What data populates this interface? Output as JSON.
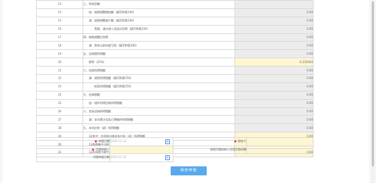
{
  "rows": [
    {
      "no": "13",
      "desc": "三、利润总额",
      "value": "",
      "indent": 0,
      "yellow": false
    },
    {
      "no": "14",
      "desc": "加：纳税调整增加额（填写附表140）",
      "value": "0.00",
      "indent": 1,
      "yellow": false
    },
    {
      "no": "15",
      "desc": "减：纳税调整减少额（填写附表140）",
      "value": "0.00",
      "indent": 1,
      "yellow": false
    },
    {
      "no": "16",
      "desc": "免税、减计收入及加计扣除（填写附表150）",
      "value": "0.00",
      "indent": 2,
      "yellow": false
    },
    {
      "no": "17",
      "desc": "四、纳税调整后所得",
      "value": "0.00",
      "indent": 0,
      "yellow": false
    },
    {
      "no": "18",
      "desc": "减：弥补以前年度亏损（填写附表160）",
      "value": "0.00",
      "indent": 1,
      "yellow": false
    },
    {
      "no": "19",
      "desc": "五、应纳税所得额",
      "value": "0.00",
      "indent": 0,
      "yellow": false
    },
    {
      "no": "20",
      "desc": "税率（25%）",
      "value": "0.250000",
      "indent": 1,
      "yellow": true
    },
    {
      "no": "21",
      "desc": "六、应纳所得税额",
      "value": "0.00",
      "indent": 0,
      "yellow": false
    },
    {
      "no": "22",
      "desc": "减：减免所得税额（填写附表150）",
      "value": "0.00",
      "indent": 1,
      "yellow": false
    },
    {
      "no": "23",
      "desc": "抵免所得税额（填写附表150）",
      "value": "0.00",
      "indent": 2,
      "yellow": false
    },
    {
      "no": "24",
      "desc": "七、应纳税额",
      "value": "0.00",
      "indent": 0,
      "yellow": false
    },
    {
      "no": "25",
      "desc": "加：境外所得应纳所得税额",
      "value": "0.00",
      "indent": 1,
      "yellow": false
    },
    {
      "no": "26",
      "desc": "八、实际应纳所得税额",
      "value": "0.00",
      "indent": 0,
      "yellow": false
    },
    {
      "no": "27",
      "desc": "减：本年累计实际已预缴的所得税额",
      "value": "0.00",
      "indent": 1,
      "yellow": false
    },
    {
      "no": "28",
      "desc": "九、本年应补（退）所得税额",
      "value": "0.00",
      "indent": 0,
      "yellow": false
    },
    {
      "no": "29",
      "desc": "12其中：总机构分摊本年应补（退）所得税额",
      "value": "0.00",
      "indent": 1,
      "yellow": true
    },
    {
      "no": "30",
      "desc": "13财政集中分配本年应补（退）所得税额",
      "value": "0.00",
      "indent": 1,
      "yellow": true
    },
    {
      "no": "31",
      "desc": "13总机构主体生产经营部门分摊本年应补（退）所得税额",
      "value": "0.00",
      "indent": 1,
      "yellow": true
    }
  ],
  "footer": {
    "declare_date_label": "申报日期",
    "declare_date_value": "2020-11-12",
    "handler_label": "经办人",
    "agent_label": "代理申报人",
    "agent_org_label": "授权代理机构人员签字和印章",
    "accept_date_label": "代理申报日期",
    "accept_date_value": "2020-11-12"
  },
  "save_button_label": "保存申报"
}
